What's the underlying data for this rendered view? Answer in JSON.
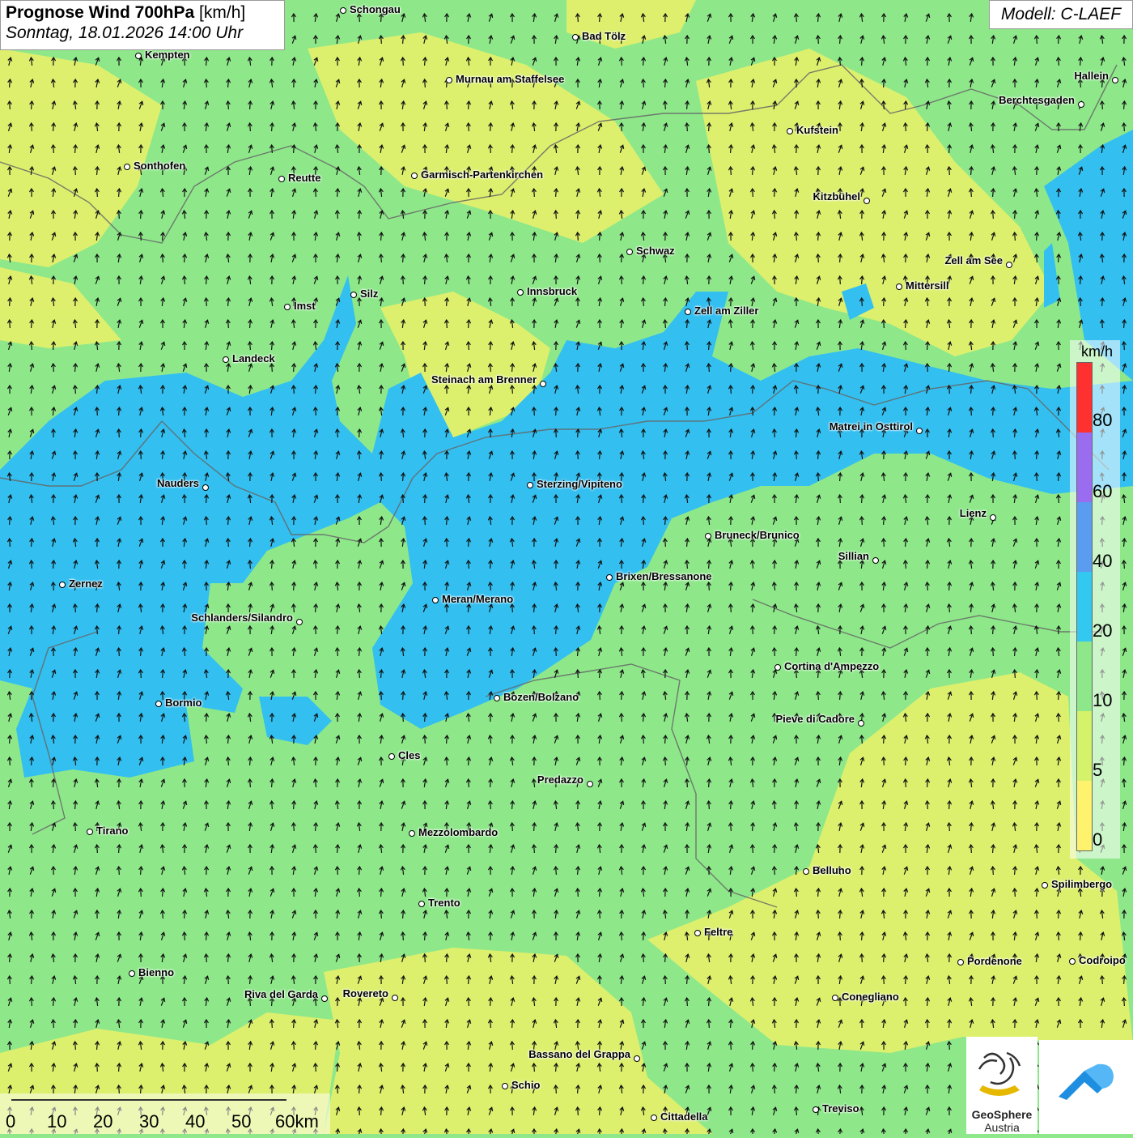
{
  "title": {
    "main": "Prognose Wind 700hPa",
    "unit": "[km/h]",
    "datetime": "Sonntag, 18.01.2026 14:00 Uhr"
  },
  "model": "Modell: C-LAEF",
  "legend": {
    "unit": "km/h",
    "labels": [
      "80",
      "60",
      "40",
      "20",
      "10",
      "5",
      "0"
    ],
    "colors": {
      "red": "#ff3030",
      "violet": "#9a6cf0",
      "blue_dark": "#5a9cf0",
      "blue": "#33c8f0",
      "green": "#8ee88a",
      "yellow_green": "#d4f26a",
      "yellow": "#fff36e"
    }
  },
  "scalebar": {
    "labels": [
      "0",
      "10",
      "20",
      "30",
      "40",
      "50",
      "60km"
    ]
  },
  "logo": {
    "name": "GeoSphere",
    "sub": "Austria"
  },
  "colors": {
    "low_wind": "#e8f06c",
    "mid_wind": "#8ee88a",
    "high_wind": "#33bff0",
    "border": "#666666",
    "arrow": "#111111"
  },
  "cities": [
    {
      "name": "Schongau"
    },
    {
      "name": "Bad Tölz"
    },
    {
      "name": "Kempten"
    },
    {
      "name": "Murnau am Staffelsee"
    },
    {
      "name": "Hallein"
    },
    {
      "name": "Berchtesgaden"
    },
    {
      "name": "Kufstein"
    },
    {
      "name": "Sonthofen"
    },
    {
      "name": "Reutte"
    },
    {
      "name": "Garmisch-Partenkirchen"
    },
    {
      "name": "Kitzbühel"
    },
    {
      "name": "Schwaz"
    },
    {
      "name": "Zell am See"
    },
    {
      "name": "Mittersill"
    },
    {
      "name": "Innsbruck"
    },
    {
      "name": "Silz"
    },
    {
      "name": "Imst"
    },
    {
      "name": "Zell am Ziller"
    },
    {
      "name": "Landeck"
    },
    {
      "name": "Steinach am Brenner"
    },
    {
      "name": "Matrei in Osttirol"
    },
    {
      "name": "Nauders"
    },
    {
      "name": "Sterzing/Vipiteno"
    },
    {
      "name": "Lienz"
    },
    {
      "name": "Bruneck/Brunico"
    },
    {
      "name": "Sillian"
    },
    {
      "name": "Zernez"
    },
    {
      "name": "Brixen/Bressanone"
    },
    {
      "name": "Meran/Merano"
    },
    {
      "name": "Schlanders/Silandro"
    },
    {
      "name": "Cortina d'Ampezzo"
    },
    {
      "name": "Bormio"
    },
    {
      "name": "Bozen/Bolzano"
    },
    {
      "name": "Pieve di Cadore"
    },
    {
      "name": "Cles"
    },
    {
      "name": "Predazzo"
    },
    {
      "name": "Tirano"
    },
    {
      "name": "Mezzolombardo"
    },
    {
      "name": "Belluno"
    },
    {
      "name": "Spilimbergo"
    },
    {
      "name": "Trento"
    },
    {
      "name": "Feltre"
    },
    {
      "name": "Bienno"
    },
    {
      "name": "Pordenone"
    },
    {
      "name": "Codroipo"
    },
    {
      "name": "Riva del Garda"
    },
    {
      "name": "Rovereto"
    },
    {
      "name": "Conegliano"
    },
    {
      "name": "Bassano del Grappa"
    },
    {
      "name": "Schio"
    },
    {
      "name": "Treviso"
    },
    {
      "name": "Cittadella"
    }
  ]
}
